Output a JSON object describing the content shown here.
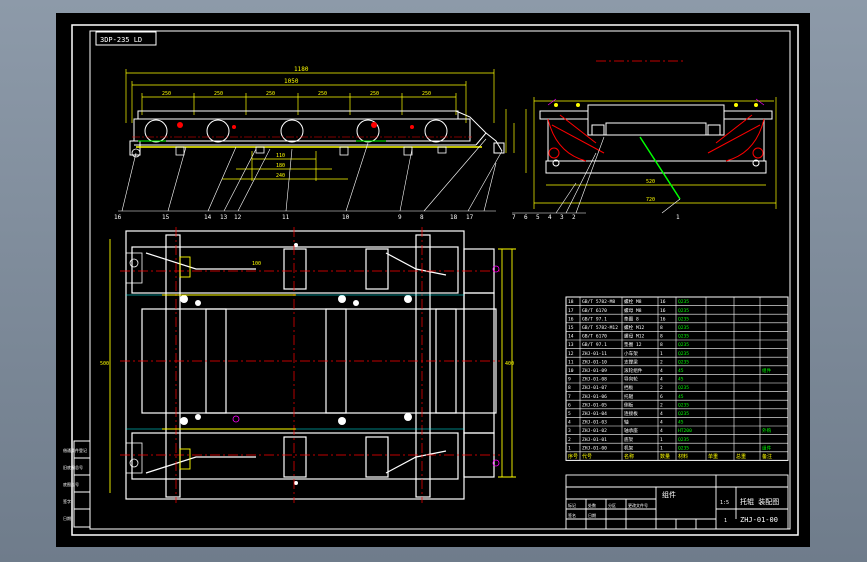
{
  "drawing": {
    "tab_label": "3DP-235 LD",
    "colors": {
      "background": "#000000",
      "frame": "#ffffff",
      "dimension": "#ffff00",
      "center_line": "#ff0000",
      "green": "#00ff00",
      "cyan": "#00ffff",
      "magenta": "#ff00ff"
    },
    "dimensions_top": [
      "1180",
      "1050",
      "250",
      "250",
      "250",
      "250",
      "250",
      "250"
    ],
    "dimensions_mid": [
      "110",
      "180",
      "240"
    ],
    "dimensions_right": [
      "100",
      "400",
      "520"
    ],
    "callouts_front": [
      "16",
      "15",
      "14",
      "13",
      "12",
      "11",
      "10",
      "9",
      "8",
      "18",
      "17"
    ],
    "callouts_side": [
      "7",
      "6",
      "5",
      "4",
      "3",
      "2",
      "1"
    ],
    "side_dims": [
      "520",
      "720"
    ],
    "plan_dims": [
      "400",
      "500",
      "100"
    ]
  },
  "parts_table": {
    "rows": [
      {
        "no": "18",
        "code": "GB/T 5782-M8",
        "name": "螺栓 M8",
        "qty": "16",
        "material": "Q235",
        "note": ""
      },
      {
        "no": "17",
        "code": "GB/T 6170",
        "name": "螺母 M8",
        "qty": "16",
        "material": "Q235",
        "note": ""
      },
      {
        "no": "16",
        "code": "GB/T 97.1",
        "name": "垫圈 8",
        "qty": "16",
        "material": "Q235",
        "note": ""
      },
      {
        "no": "15",
        "code": "GB/T 5782-M12",
        "name": "螺栓 M12",
        "qty": "8",
        "material": "Q235",
        "note": ""
      },
      {
        "no": "14",
        "code": "GB/T 6170",
        "name": "螺母 M12",
        "qty": "8",
        "material": "Q235",
        "note": ""
      },
      {
        "no": "13",
        "code": "GB/T 97.1",
        "name": "垫圈 12",
        "qty": "8",
        "material": "Q235",
        "note": ""
      },
      {
        "no": "12",
        "code": "ZHJ-01-11",
        "name": "小车架",
        "qty": "1",
        "material": "Q235",
        "note": ""
      },
      {
        "no": "11",
        "code": "ZHJ-01-10",
        "name": "支撑梁",
        "qty": "2",
        "material": "Q235",
        "note": ""
      },
      {
        "no": "10",
        "code": "ZHJ-01-09",
        "name": "滚轮组件",
        "qty": "4",
        "material": "45",
        "note": "组件"
      },
      {
        "no": "9",
        "code": "ZHJ-01-08",
        "name": "导向轮",
        "qty": "4",
        "material": "45",
        "note": ""
      },
      {
        "no": "8",
        "code": "ZHJ-01-07",
        "name": "挡板",
        "qty": "2",
        "material": "Q235",
        "note": ""
      },
      {
        "no": "7",
        "code": "ZHJ-01-06",
        "name": "托辊",
        "qty": "6",
        "material": "45",
        "note": ""
      },
      {
        "no": "6",
        "code": "ZHJ-01-05",
        "name": "侧板",
        "qty": "2",
        "material": "Q235",
        "note": ""
      },
      {
        "no": "5",
        "code": "ZHJ-01-04",
        "name": "连接板",
        "qty": "4",
        "material": "Q235",
        "note": ""
      },
      {
        "no": "4",
        "code": "ZHJ-01-03",
        "name": "轴",
        "qty": "4",
        "material": "45",
        "note": ""
      },
      {
        "no": "3",
        "code": "ZHJ-01-02",
        "name": "轴承座",
        "qty": "4",
        "material": "HT200",
        "note": "外购"
      },
      {
        "no": "2",
        "code": "ZHJ-01-01",
        "name": "底架",
        "qty": "1",
        "material": "Q235",
        "note": ""
      },
      {
        "no": "1",
        "code": "ZHJ-01-00",
        "name": "机架",
        "qty": "1",
        "material": "Q235",
        "note": "组件"
      }
    ],
    "headers": [
      "序号",
      "代号",
      "名称",
      "数量",
      "材料",
      "单重",
      "总重",
      "备注"
    ]
  },
  "title_block": {
    "drawing_name": "组件",
    "assembly_title": "托辊 装配图",
    "drawing_number": "ZHJ-01-00",
    "scale": "1:5",
    "sheet": "1",
    "revision_labels": [
      "标记",
      "处数",
      "分区",
      "更改文件号",
      "签名",
      "日期"
    ]
  },
  "left_margin_labels": [
    "借通用件登记",
    "旧底图总号",
    "底图总号",
    "签字",
    "日期"
  ]
}
